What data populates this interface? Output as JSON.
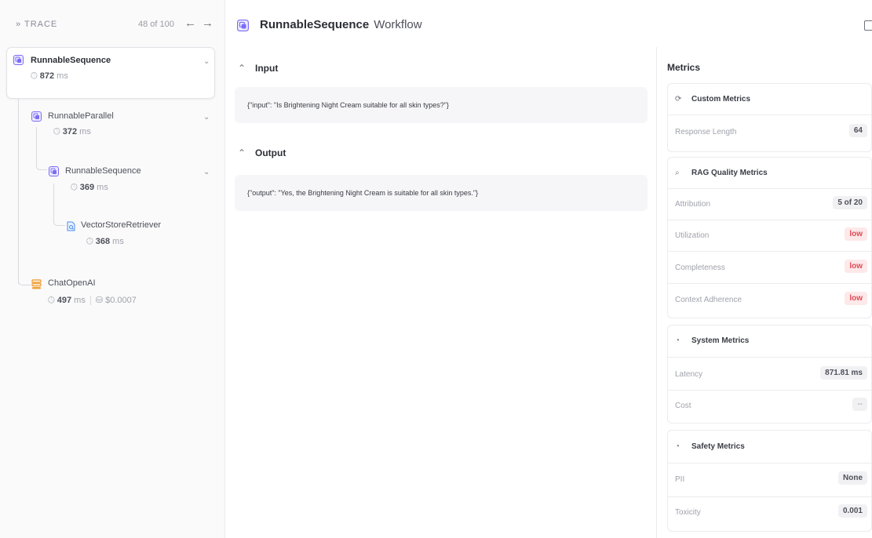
{
  "trace": {
    "title": "» TRACE",
    "count": "48 of 100",
    "prev": "←",
    "next": "→"
  },
  "tree": {
    "root": {
      "name": "RunnableSequence",
      "time_value": "872",
      "time_unit": " ms"
    },
    "parallel": {
      "name": "RunnableParallel",
      "time_value": "372",
      "time_unit": " ms"
    },
    "inner_sequence": {
      "name": "RunnableSequence",
      "time_value": "369",
      "time_unit": " ms"
    },
    "retriever": {
      "name": "VectorStoreRetriever",
      "time_value": "368",
      "time_unit": " ms"
    },
    "llm": {
      "name": "ChatOpenAI",
      "time_value": "497",
      "time_unit": " ms",
      "cost": "$0.0007"
    }
  },
  "header": {
    "title": "RunnableSequence",
    "subtitle": "Workflow"
  },
  "input": {
    "label": "Input",
    "content": "{\"input\": \"Is Brightening Night Cream suitable for all skin types?\"}"
  },
  "output": {
    "label": "Output",
    "content": "{\"output\": \"Yes, the Brightening Night Cream is suitable for all skin types.\"}"
  },
  "metrics": {
    "title": "Metrics",
    "custom": {
      "title": "Custom Metrics",
      "rows": [
        {
          "label": "Response Length",
          "value": "64"
        }
      ]
    },
    "rag": {
      "title": "RAG Quality Metrics",
      "rows": [
        {
          "label": "Attribution",
          "value": "5 of 20"
        },
        {
          "label": "Utilization",
          "value": "low"
        },
        {
          "label": "Completeness",
          "value": "low"
        },
        {
          "label": "Context Adherence",
          "value": "low"
        }
      ]
    },
    "system": {
      "title": "System Metrics",
      "rows": [
        {
          "label": "Latency",
          "value": "871.81 ms"
        },
        {
          "label": "Cost",
          "value": "--"
        }
      ]
    },
    "safety": {
      "title": "Safety Metrics",
      "rows": [
        {
          "label": "PII",
          "value": "None"
        },
        {
          "label": "Toxicity",
          "value": "0.001"
        }
      ]
    }
  },
  "icons": {
    "sequence": "stacked-squares-icon",
    "clock": "clock-icon",
    "retriever": "document-search-icon",
    "llm": "database-icon",
    "cost": "coins-icon"
  },
  "colors": {
    "accent": "#7b6cf6",
    "llm_icon": "#f0a23b",
    "low_badge_text": "#e04b54",
    "low_badge_bg": "#fde8ea"
  }
}
